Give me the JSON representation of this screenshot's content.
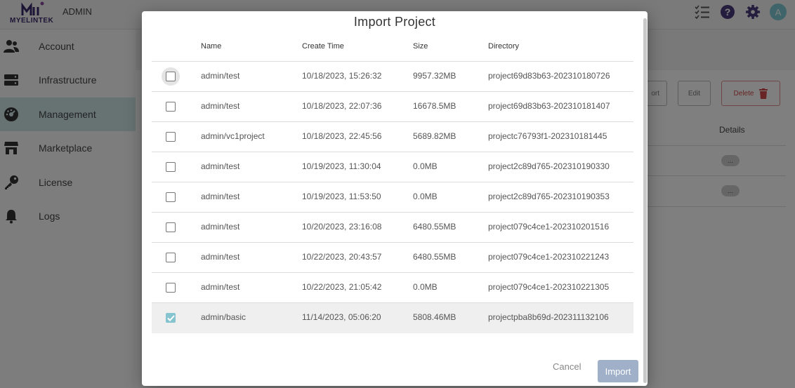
{
  "app": {
    "logo_text": "MYELINTEK",
    "title": "ADMIN",
    "avatar_letter": "A"
  },
  "sidebar": {
    "items": [
      {
        "label": "Account",
        "icon": "users-icon"
      },
      {
        "label": "Infrastructure",
        "icon": "server-icon"
      },
      {
        "label": "Management",
        "icon": "dashboard-icon",
        "active": true
      },
      {
        "label": "Marketplace",
        "icon": "store-icon"
      },
      {
        "label": "License",
        "icon": "key-icon"
      },
      {
        "label": "Logs",
        "icon": "bell-icon"
      }
    ]
  },
  "background_actions": {
    "partial_label": "ort",
    "edit_label": "Edit",
    "delete_label": "Delete",
    "details_header": "Details",
    "dots": "..."
  },
  "modal": {
    "title": "Import Project",
    "columns": {
      "name": "Name",
      "create_time": "Create Time",
      "size": "Size",
      "directory": "Directory"
    },
    "rows": [
      {
        "name": "admin/test",
        "create_time": "10/18/2023, 15:26:32",
        "size": "9957.32MB",
        "directory": "project69d83b63-202310180726",
        "checked": false
      },
      {
        "name": "admin/test",
        "create_time": "10/18/2023, 22:07:36",
        "size": "16678.5MB",
        "directory": "project69d83b63-202310181407",
        "checked": false
      },
      {
        "name": "admin/vc1project",
        "create_time": "10/18/2023, 22:45:56",
        "size": "5689.82MB",
        "directory": "projectc76793f1-202310181445",
        "checked": false
      },
      {
        "name": "admin/test",
        "create_time": "10/19/2023, 11:30:04",
        "size": "0.0MB",
        "directory": "project2c89d765-202310190330",
        "checked": false
      },
      {
        "name": "admin/test",
        "create_time": "10/19/2023, 11:53:50",
        "size": "0.0MB",
        "directory": "project2c89d765-202310190353",
        "checked": false
      },
      {
        "name": "admin/test",
        "create_time": "10/20/2023, 23:16:08",
        "size": "6480.55MB",
        "directory": "project079c4ce1-202310201516",
        "checked": false
      },
      {
        "name": "admin/test",
        "create_time": "10/22/2023, 20:43:57",
        "size": "6480.55MB",
        "directory": "project079c4ce1-202310221243",
        "checked": false
      },
      {
        "name": "admin/test",
        "create_time": "10/22/2023, 21:05:42",
        "size": "0.0MB",
        "directory": "project079c4ce1-202310221305",
        "checked": false
      },
      {
        "name": "admin/basic",
        "create_time": "11/14/2023, 05:06:20",
        "size": "5808.46MB",
        "directory": "projectpba8b69d-202311132106",
        "checked": true
      }
    ],
    "cancel_label": "Cancel",
    "import_label": "Import"
  },
  "colors": {
    "accent": "#86c4cf",
    "import_button": "#9fb0c8",
    "active_sidebar": "#cfe6e6",
    "brand_purple": "#3b2a6b",
    "delete_red": "#d24a4a"
  }
}
